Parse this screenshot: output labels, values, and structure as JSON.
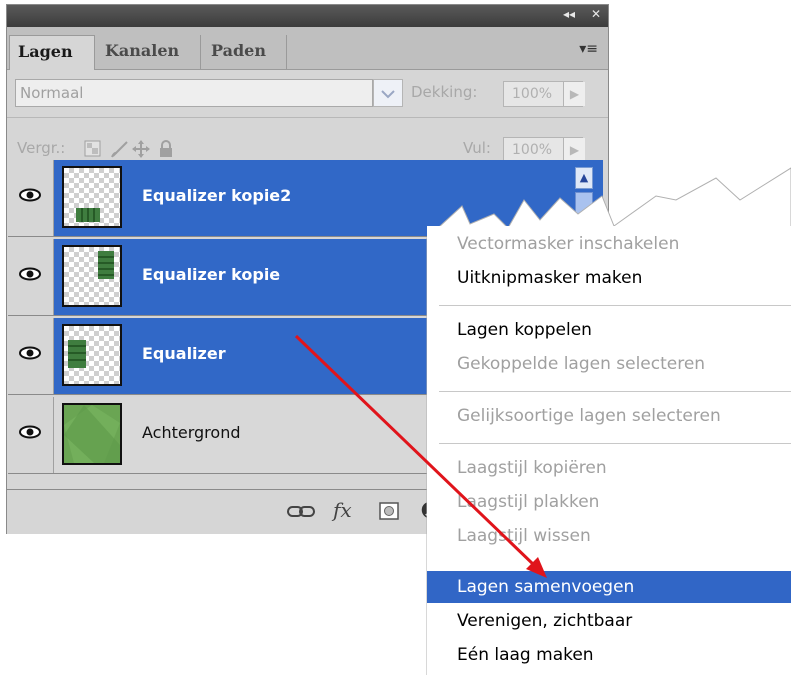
{
  "panel": {
    "title_controls": {
      "collapse": "◂◂",
      "close": "✕"
    },
    "tabs": [
      {
        "label": "Lagen",
        "active": true
      },
      {
        "label": "Kanalen",
        "active": false
      },
      {
        "label": "Paden",
        "active": false
      }
    ],
    "menu_icon": "▾≡",
    "blend_mode": {
      "value": "Normaal"
    },
    "opacity": {
      "label": "Dekking:",
      "value": "100%"
    },
    "lock": {
      "label": "Vergr.:",
      "icons": [
        "lock-transparency-icon",
        "lock-image-icon",
        "lock-position-icon",
        "lock-all-icon"
      ]
    },
    "fill": {
      "label": "Vul:",
      "value": "100%"
    },
    "layers": [
      {
        "name": "Equalizer kopie2",
        "selected": true,
        "visible": true
      },
      {
        "name": "Equalizer kopie",
        "selected": true,
        "visible": true
      },
      {
        "name": "Equalizer",
        "selected": true,
        "visible": true
      },
      {
        "name": "Achtergrond",
        "selected": false,
        "visible": true
      }
    ],
    "bottom_icons": [
      "link-layers-icon",
      "layer-style-fx-icon",
      "layer-mask-icon",
      "adjustment-layer-icon"
    ],
    "bottom_labels": {
      "fx": "fx"
    }
  },
  "context_menu": {
    "items": [
      {
        "label": "Vectormasker inschakelen",
        "enabled": false
      },
      {
        "label": "Uitknipmasker maken",
        "enabled": true
      },
      {
        "label": "Lagen koppelen",
        "enabled": true
      },
      {
        "label": "Gekoppelde lagen selecteren",
        "enabled": false
      },
      {
        "label": "Gelijksoortige lagen selecteren",
        "enabled": false
      },
      {
        "label": "Laagstijl kopiëren",
        "enabled": false
      },
      {
        "label": "Laagstijl plakken",
        "enabled": false
      },
      {
        "label": "Laagstijl wissen",
        "enabled": false
      },
      {
        "label": "Lagen samenvoegen",
        "enabled": true,
        "highlighted": true
      },
      {
        "label": "Verenigen, zichtbaar",
        "enabled": true
      },
      {
        "label": "Eén laag maken",
        "enabled": true
      }
    ]
  },
  "colors": {
    "selection_blue": "#3168c7",
    "menu_highlight": "#3166c6",
    "annotation_arrow": "#e0141b",
    "disabled_text": "#a0a0a0"
  }
}
